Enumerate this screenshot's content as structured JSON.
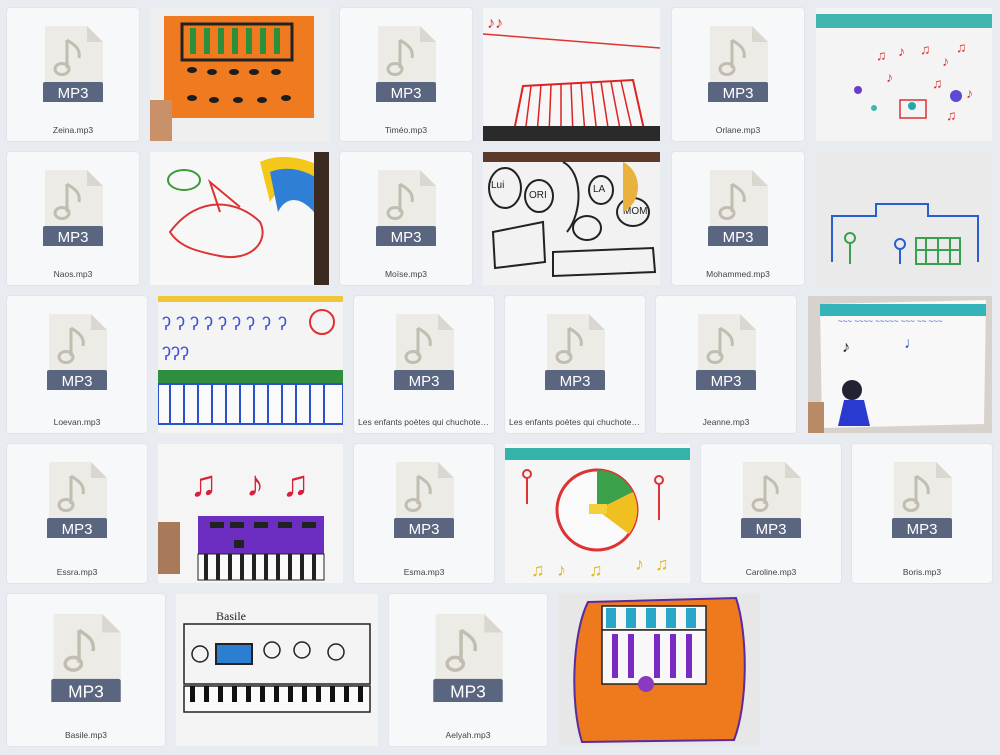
{
  "ui": {
    "mp3_badge": "MP3",
    "badge_color": "#5a6580",
    "doc_color": "#ecebe5",
    "note_color": "#c2bdb0"
  },
  "files": [
    {
      "name": "Zeina.mp3"
    },
    {
      "name": "Timéo.mp3"
    },
    {
      "name": "Orlane.mp3"
    },
    {
      "name": "Naos.mp3"
    },
    {
      "name": "Moïse.mp3"
    },
    {
      "name": "Mohammed.mp3"
    },
    {
      "name": "Loevan.mp3"
    },
    {
      "name": "Les enfants poètes qui chuchoten..."
    },
    {
      "name": "Les enfants poètes qui chuchoten..."
    },
    {
      "name": "Jeanne.mp3"
    },
    {
      "name": "Essra.mp3"
    },
    {
      "name": "Esma.mp3"
    },
    {
      "name": "Caroline.mp3"
    },
    {
      "name": "Boris.mp3"
    },
    {
      "name": "Basile.mp3"
    },
    {
      "name": "Aelyah.mp3"
    }
  ],
  "drawings": [
    {
      "icon": "keyboard-drawing-orange"
    },
    {
      "icon": "piano-drawing-red"
    },
    {
      "icon": "music-notes-drawing"
    },
    {
      "icon": "bird-drawing"
    },
    {
      "icon": "music-chorale-drawing"
    },
    {
      "icon": "stage-drawing"
    },
    {
      "icon": "piano-notes-sun-drawing"
    },
    {
      "icon": "child-with-notes-drawing"
    },
    {
      "icon": "notes-piano-purple-drawing"
    },
    {
      "icon": "clock-notes-drawing"
    },
    {
      "icon": "basile-piano-drawing"
    },
    {
      "icon": "radio-drawing-orange"
    }
  ]
}
